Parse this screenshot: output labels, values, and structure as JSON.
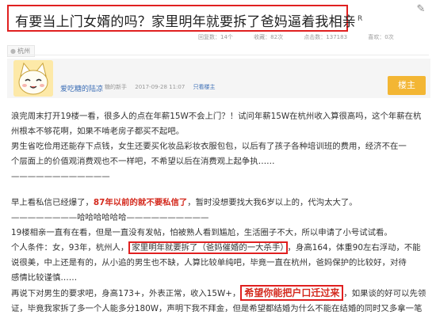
{
  "thread": {
    "title": "有要当上门女婿的吗？家里明年就要拆了爸妈逼着我相亲",
    "title_suffix": "R",
    "stats": {
      "replies": "回复数：14个",
      "views": "收藏：82次",
      "reads": "点击数：137183",
      "likes": "喜欢：0次"
    },
    "tag": "杭州"
  },
  "post": {
    "username": "爱吃糖的陆凉",
    "level": "糖的新手",
    "time": "2017-09-28 11:07",
    "author_only": "只看楼主",
    "floor": "楼主"
  },
  "content": {
    "line1": "浪完周末打开19楼一看，很多人的点在年薪15W不会上门？！试问年薪15W在杭州收入算很高吗，这个年薪在杭",
    "line2": "州根本不够花啊，如果不啃老房子都买不起吧。",
    "line3": "男生省吃俭用还能存下点钱，女生还要买化妆品彩妆衣服包包，以后有了孩子各种培训班的费用，经济不在一",
    "line4": "个层面上的价值观消费观也不一样吧，不希望以后在消费观上起争执……",
    "dashes1": "————————————",
    "line5_pre": "早上看私信已经爆了，",
    "line5_red": "87年以前的就不要私信了",
    "line5_post": "，暂时没想要找大我6岁以上的，代沟太大了。",
    "line6": "————————哈哈哈哈哈哈——————————",
    "line7": "19楼相亲一直有在看，但是一直没有发帖，怕被熟人看到尴尬，生活圈子不大，所以申请了小号试试看。",
    "line8_pre": "个人条件：女，93年，杭州人，",
    "line8_box": "家里明年就要拆了（爸妈催婚的一大杀手）",
    "line8_post": "，身高164，体重90左右浮动，不能",
    "line9": "说很美，中上还是有的，从小追的男生也不缺，人算比较单纯吧，毕竟一直在杭州，爸妈保护的比较好，对待",
    "line10": "感情比较谨慎……",
    "line11_pre": "再说下对男生的要求吧，身高173+，外表正常，收入15W+，",
    "line11_box": "希望你能把户口迁过来",
    "line11_post": "，如果谈的好可以先领",
    "line12": "证，毕竟我家拆了多一个人能多分180W，声明下我不拜金，但是希望都结婚为什么不能在结婚的同时又多拿一笔"
  },
  "colors": {
    "highlight_red": "#e02020",
    "text_red": "#d42a1e",
    "link_blue": "#3d6fb6",
    "badge_orange": "#f3b634"
  }
}
